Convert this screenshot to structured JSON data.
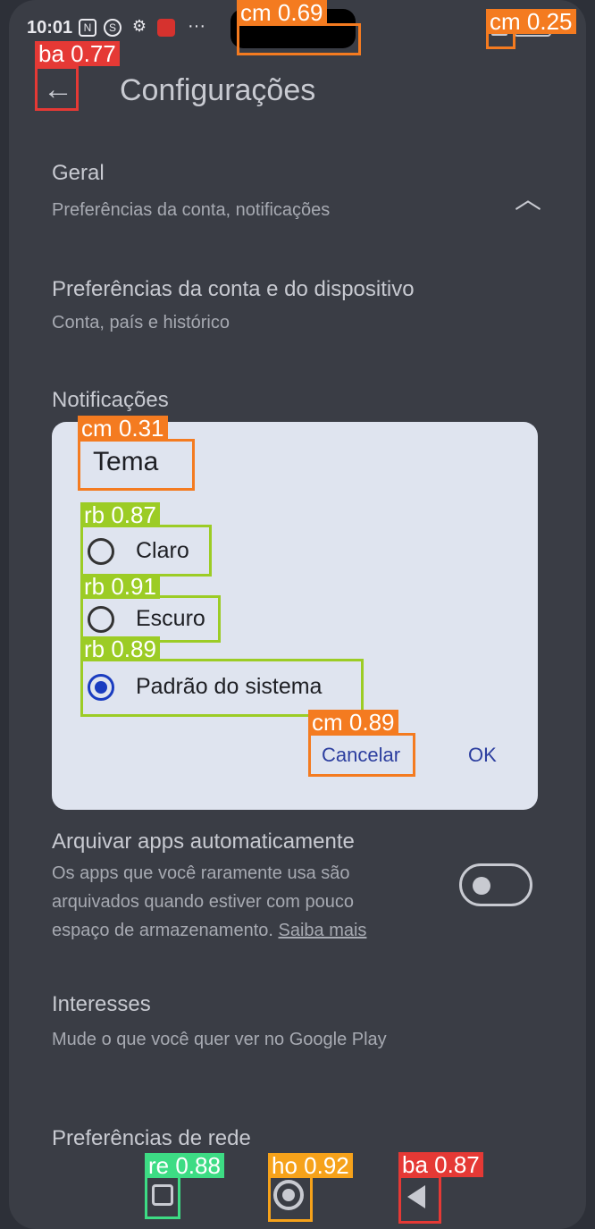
{
  "status_bar": {
    "time": "10:01",
    "icons": [
      "nfc-icon",
      "sim-icon",
      "gear-icon",
      "app-notification-icon",
      "more-icon"
    ],
    "more": "···"
  },
  "header": {
    "back_icon": "←",
    "title": "Configurações"
  },
  "sections": {
    "geral": {
      "title": "Geral",
      "subtitle": "Preferências da conta, notificações",
      "chevron": "︿"
    },
    "prefs": {
      "title": "Preferências da conta e do dispositivo",
      "subtitle": "Conta, país e histórico"
    },
    "notificacoes": {
      "title": "Notificações"
    },
    "arquivar": {
      "title": "Arquivar apps automaticamente",
      "line1": "Os apps que você raramente usa são",
      "line2": "arquivados quando estiver com pouco",
      "line3": "espaço de armazenamento.",
      "link": "Saiba mais",
      "toggle_on": false
    },
    "interesses": {
      "title": "Interesses",
      "subtitle": "Mude o que você quer ver no Google Play"
    },
    "rede": {
      "title": "Preferências de rede"
    }
  },
  "dialog": {
    "title": "Tema",
    "options": [
      {
        "label": "Claro",
        "checked": false
      },
      {
        "label": "Escuro",
        "checked": false
      },
      {
        "label": "Padrão do sistema",
        "checked": true
      }
    ],
    "cancel": "Cancelar",
    "ok": "OK"
  },
  "annotations": [
    {
      "label": "cm 0.69",
      "color": "#f47b20"
    },
    {
      "label": "cm 0.25",
      "color": "#f47b20"
    },
    {
      "label": "ba 0.77",
      "color": "#e53935"
    },
    {
      "label": "cm 0.31",
      "color": "#f47b20"
    },
    {
      "label": "rb 0.87",
      "color": "#9ccc25"
    },
    {
      "label": "rb 0.91",
      "color": "#9ccc25"
    },
    {
      "label": "rb 0.89",
      "color": "#9ccc25"
    },
    {
      "label": "cm 0.89",
      "color": "#f47b20"
    },
    {
      "label": "re 0.88",
      "color": "#3ddc84"
    },
    {
      "label": "ho 0.92",
      "color": "#f6a21a"
    },
    {
      "label": "ba 0.87",
      "color": "#e53935"
    }
  ]
}
